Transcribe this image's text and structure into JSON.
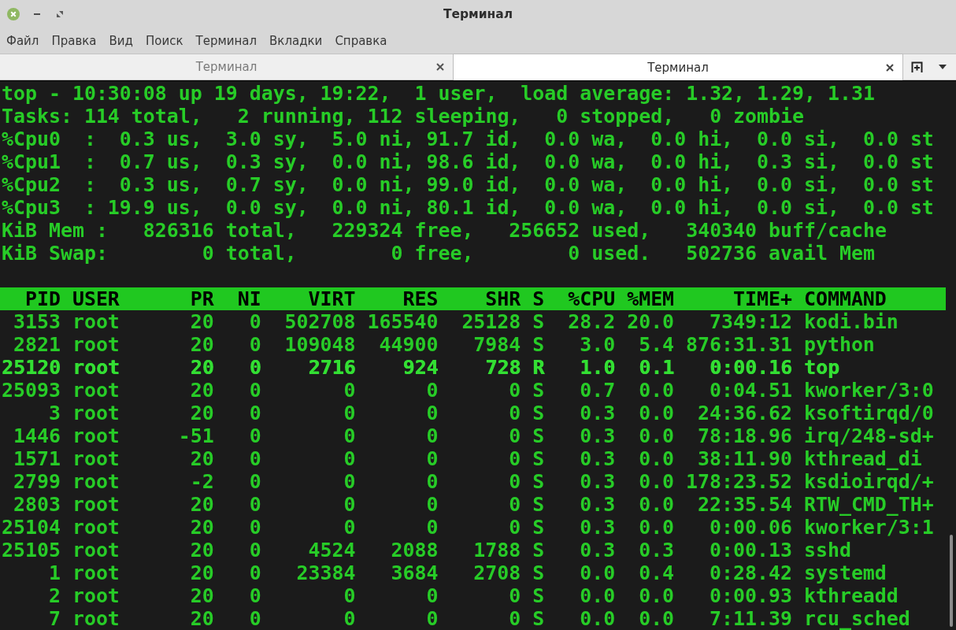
{
  "window": {
    "title": "Терминал"
  },
  "menu": [
    "Файл",
    "Правка",
    "Вид",
    "Поиск",
    "Терминал",
    "Вкладки",
    "Справка"
  ],
  "tabs": [
    {
      "label": "Терминал",
      "selected": false
    },
    {
      "label": "Терминал",
      "selected": true
    }
  ],
  "terminal": {
    "summary": [
      "top - 10:30:08 up 19 days, 19:22,  1 user,  load average: 1.32, 1.29, 1.31",
      "Tasks: 114 total,   2 running, 112 sleeping,   0 stopped,   0 zombie",
      "%Cpu0  :  0.3 us,  3.0 sy,  5.0 ni, 91.7 id,  0.0 wa,  0.0 hi,  0.0 si,  0.0 st",
      "%Cpu1  :  0.7 us,  0.3 sy,  0.0 ni, 98.6 id,  0.0 wa,  0.0 hi,  0.3 si,  0.0 st",
      "%Cpu2  :  0.3 us,  0.7 sy,  0.0 ni, 99.0 id,  0.0 wa,  0.0 hi,  0.0 si,  0.0 st",
      "%Cpu3  : 19.9 us,  0.0 sy,  0.0 ni, 80.1 id,  0.0 wa,  0.0 hi,  0.0 si,  0.0 st",
      "KiB Mem :   826316 total,   229324 free,   256652 used,   340340 buff/cache",
      "KiB Swap:        0 total,        0 free,        0 used.   502736 avail Mem"
    ],
    "table": {
      "columns": [
        "PID",
        "USER",
        "PR",
        "NI",
        "VIRT",
        "RES",
        "SHR",
        "S",
        "%CPU",
        "%MEM",
        "TIME+",
        "COMMAND"
      ],
      "rows": [
        {
          "cells": [
            "3153",
            "root",
            "20",
            "0",
            "502708",
            "165540",
            "25128",
            "S",
            "28.2",
            "20.0",
            "7349:12",
            "kodi.bin"
          ],
          "highlighted": false
        },
        {
          "cells": [
            "2821",
            "root",
            "20",
            "0",
            "109048",
            "44900",
            "7984",
            "S",
            "3.0",
            "5.4",
            "876:31.31",
            "python"
          ],
          "highlighted": false
        },
        {
          "cells": [
            "25120",
            "root",
            "20",
            "0",
            "2716",
            "924",
            "728",
            "R",
            "1.0",
            "0.1",
            "0:00.16",
            "top"
          ],
          "highlighted": true
        },
        {
          "cells": [
            "25093",
            "root",
            "20",
            "0",
            "0",
            "0",
            "0",
            "S",
            "0.7",
            "0.0",
            "0:04.51",
            "kworker/3:0"
          ],
          "highlighted": false
        },
        {
          "cells": [
            "3",
            "root",
            "20",
            "0",
            "0",
            "0",
            "0",
            "S",
            "0.3",
            "0.0",
            "24:36.62",
            "ksoftirqd/0"
          ],
          "highlighted": false
        },
        {
          "cells": [
            "1446",
            "root",
            "-51",
            "0",
            "0",
            "0",
            "0",
            "S",
            "0.3",
            "0.0",
            "78:18.96",
            "irq/248-sd+"
          ],
          "highlighted": false
        },
        {
          "cells": [
            "1571",
            "root",
            "20",
            "0",
            "0",
            "0",
            "0",
            "S",
            "0.3",
            "0.0",
            "38:11.90",
            "kthread_di"
          ],
          "highlighted": false
        },
        {
          "cells": [
            "2799",
            "root",
            "-2",
            "0",
            "0",
            "0",
            "0",
            "S",
            "0.3",
            "0.0",
            "178:23.52",
            "ksdioirqd/+"
          ],
          "highlighted": false
        },
        {
          "cells": [
            "2803",
            "root",
            "20",
            "0",
            "0",
            "0",
            "0",
            "S",
            "0.3",
            "0.0",
            "22:35.54",
            "RTW_CMD_TH+"
          ],
          "highlighted": false
        },
        {
          "cells": [
            "25104",
            "root",
            "20",
            "0",
            "0",
            "0",
            "0",
            "S",
            "0.3",
            "0.0",
            "0:00.06",
            "kworker/3:1"
          ],
          "highlighted": false
        },
        {
          "cells": [
            "25105",
            "root",
            "20",
            "0",
            "4524",
            "2088",
            "1788",
            "S",
            "0.3",
            "0.3",
            "0:00.13",
            "sshd"
          ],
          "highlighted": false
        },
        {
          "cells": [
            "1",
            "root",
            "20",
            "0",
            "23384",
            "3684",
            "2708",
            "S",
            "0.0",
            "0.4",
            "0:28.42",
            "systemd"
          ],
          "highlighted": false
        },
        {
          "cells": [
            "2",
            "root",
            "20",
            "0",
            "0",
            "0",
            "0",
            "S",
            "0.0",
            "0.0",
            "0:00.93",
            "kthreadd"
          ],
          "highlighted": false
        },
        {
          "cells": [
            "7",
            "root",
            "20",
            "0",
            "0",
            "0",
            "0",
            "S",
            "0.0",
            "0.0",
            "7:11.39",
            "rcu_sched"
          ],
          "highlighted": false
        }
      ]
    }
  }
}
